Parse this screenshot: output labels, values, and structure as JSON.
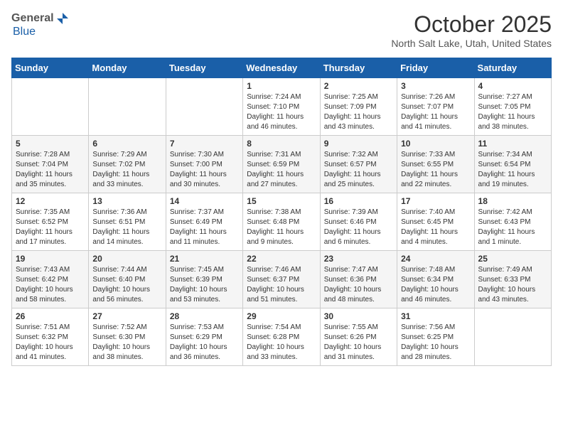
{
  "logo": {
    "general": "General",
    "blue": "Blue"
  },
  "header": {
    "month": "October 2025",
    "location": "North Salt Lake, Utah, United States"
  },
  "weekdays": [
    "Sunday",
    "Monday",
    "Tuesday",
    "Wednesday",
    "Thursday",
    "Friday",
    "Saturday"
  ],
  "weeks": [
    [
      {
        "day": "",
        "sunrise": "",
        "sunset": "",
        "daylight": ""
      },
      {
        "day": "",
        "sunrise": "",
        "sunset": "",
        "daylight": ""
      },
      {
        "day": "",
        "sunrise": "",
        "sunset": "",
        "daylight": ""
      },
      {
        "day": "1",
        "sunrise": "Sunrise: 7:24 AM",
        "sunset": "Sunset: 7:10 PM",
        "daylight": "Daylight: 11 hours and 46 minutes."
      },
      {
        "day": "2",
        "sunrise": "Sunrise: 7:25 AM",
        "sunset": "Sunset: 7:09 PM",
        "daylight": "Daylight: 11 hours and 43 minutes."
      },
      {
        "day": "3",
        "sunrise": "Sunrise: 7:26 AM",
        "sunset": "Sunset: 7:07 PM",
        "daylight": "Daylight: 11 hours and 41 minutes."
      },
      {
        "day": "4",
        "sunrise": "Sunrise: 7:27 AM",
        "sunset": "Sunset: 7:05 PM",
        "daylight": "Daylight: 11 hours and 38 minutes."
      }
    ],
    [
      {
        "day": "5",
        "sunrise": "Sunrise: 7:28 AM",
        "sunset": "Sunset: 7:04 PM",
        "daylight": "Daylight: 11 hours and 35 minutes."
      },
      {
        "day": "6",
        "sunrise": "Sunrise: 7:29 AM",
        "sunset": "Sunset: 7:02 PM",
        "daylight": "Daylight: 11 hours and 33 minutes."
      },
      {
        "day": "7",
        "sunrise": "Sunrise: 7:30 AM",
        "sunset": "Sunset: 7:00 PM",
        "daylight": "Daylight: 11 hours and 30 minutes."
      },
      {
        "day": "8",
        "sunrise": "Sunrise: 7:31 AM",
        "sunset": "Sunset: 6:59 PM",
        "daylight": "Daylight: 11 hours and 27 minutes."
      },
      {
        "day": "9",
        "sunrise": "Sunrise: 7:32 AM",
        "sunset": "Sunset: 6:57 PM",
        "daylight": "Daylight: 11 hours and 25 minutes."
      },
      {
        "day": "10",
        "sunrise": "Sunrise: 7:33 AM",
        "sunset": "Sunset: 6:55 PM",
        "daylight": "Daylight: 11 hours and 22 minutes."
      },
      {
        "day": "11",
        "sunrise": "Sunrise: 7:34 AM",
        "sunset": "Sunset: 6:54 PM",
        "daylight": "Daylight: 11 hours and 19 minutes."
      }
    ],
    [
      {
        "day": "12",
        "sunrise": "Sunrise: 7:35 AM",
        "sunset": "Sunset: 6:52 PM",
        "daylight": "Daylight: 11 hours and 17 minutes."
      },
      {
        "day": "13",
        "sunrise": "Sunrise: 7:36 AM",
        "sunset": "Sunset: 6:51 PM",
        "daylight": "Daylight: 11 hours and 14 minutes."
      },
      {
        "day": "14",
        "sunrise": "Sunrise: 7:37 AM",
        "sunset": "Sunset: 6:49 PM",
        "daylight": "Daylight: 11 hours and 11 minutes."
      },
      {
        "day": "15",
        "sunrise": "Sunrise: 7:38 AM",
        "sunset": "Sunset: 6:48 PM",
        "daylight": "Daylight: 11 hours and 9 minutes."
      },
      {
        "day": "16",
        "sunrise": "Sunrise: 7:39 AM",
        "sunset": "Sunset: 6:46 PM",
        "daylight": "Daylight: 11 hours and 6 minutes."
      },
      {
        "day": "17",
        "sunrise": "Sunrise: 7:40 AM",
        "sunset": "Sunset: 6:45 PM",
        "daylight": "Daylight: 11 hours and 4 minutes."
      },
      {
        "day": "18",
        "sunrise": "Sunrise: 7:42 AM",
        "sunset": "Sunset: 6:43 PM",
        "daylight": "Daylight: 11 hours and 1 minute."
      }
    ],
    [
      {
        "day": "19",
        "sunrise": "Sunrise: 7:43 AM",
        "sunset": "Sunset: 6:42 PM",
        "daylight": "Daylight: 10 hours and 58 minutes."
      },
      {
        "day": "20",
        "sunrise": "Sunrise: 7:44 AM",
        "sunset": "Sunset: 6:40 PM",
        "daylight": "Daylight: 10 hours and 56 minutes."
      },
      {
        "day": "21",
        "sunrise": "Sunrise: 7:45 AM",
        "sunset": "Sunset: 6:39 PM",
        "daylight": "Daylight: 10 hours and 53 minutes."
      },
      {
        "day": "22",
        "sunrise": "Sunrise: 7:46 AM",
        "sunset": "Sunset: 6:37 PM",
        "daylight": "Daylight: 10 hours and 51 minutes."
      },
      {
        "day": "23",
        "sunrise": "Sunrise: 7:47 AM",
        "sunset": "Sunset: 6:36 PM",
        "daylight": "Daylight: 10 hours and 48 minutes."
      },
      {
        "day": "24",
        "sunrise": "Sunrise: 7:48 AM",
        "sunset": "Sunset: 6:34 PM",
        "daylight": "Daylight: 10 hours and 46 minutes."
      },
      {
        "day": "25",
        "sunrise": "Sunrise: 7:49 AM",
        "sunset": "Sunset: 6:33 PM",
        "daylight": "Daylight: 10 hours and 43 minutes."
      }
    ],
    [
      {
        "day": "26",
        "sunrise": "Sunrise: 7:51 AM",
        "sunset": "Sunset: 6:32 PM",
        "daylight": "Daylight: 10 hours and 41 minutes."
      },
      {
        "day": "27",
        "sunrise": "Sunrise: 7:52 AM",
        "sunset": "Sunset: 6:30 PM",
        "daylight": "Daylight: 10 hours and 38 minutes."
      },
      {
        "day": "28",
        "sunrise": "Sunrise: 7:53 AM",
        "sunset": "Sunset: 6:29 PM",
        "daylight": "Daylight: 10 hours and 36 minutes."
      },
      {
        "day": "29",
        "sunrise": "Sunrise: 7:54 AM",
        "sunset": "Sunset: 6:28 PM",
        "daylight": "Daylight: 10 hours and 33 minutes."
      },
      {
        "day": "30",
        "sunrise": "Sunrise: 7:55 AM",
        "sunset": "Sunset: 6:26 PM",
        "daylight": "Daylight: 10 hours and 31 minutes."
      },
      {
        "day": "31",
        "sunrise": "Sunrise: 7:56 AM",
        "sunset": "Sunset: 6:25 PM",
        "daylight": "Daylight: 10 hours and 28 minutes."
      },
      {
        "day": "",
        "sunrise": "",
        "sunset": "",
        "daylight": ""
      }
    ]
  ]
}
